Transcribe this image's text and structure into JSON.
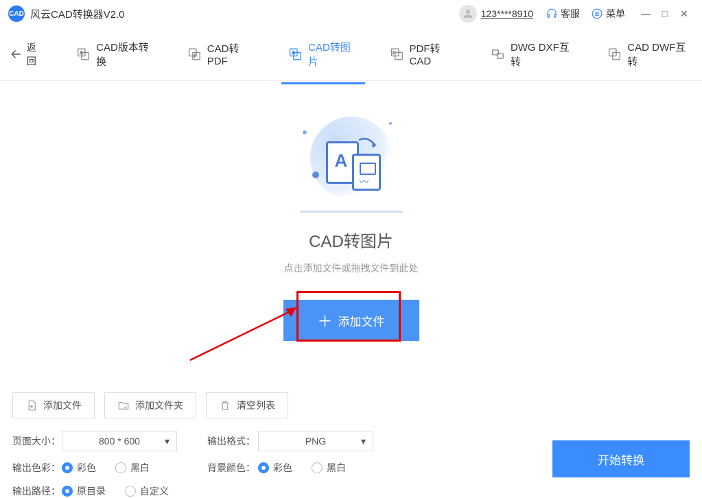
{
  "titlebar": {
    "app_title": "风云CAD转换器V2.0",
    "user_id": "123****8910",
    "support": "客服",
    "menu": "菜单"
  },
  "tabs": {
    "back": "返回",
    "items": [
      {
        "label": "CAD版本转换"
      },
      {
        "label": "CAD转PDF"
      },
      {
        "label": "CAD转图片"
      },
      {
        "label": "PDF转CAD"
      },
      {
        "label": "DWG DXF互转"
      },
      {
        "label": "CAD DWF互转"
      }
    ]
  },
  "main": {
    "title": "CAD转图片",
    "subtitle": "点击添加文件或拖拽文件到此处",
    "add_file": "添加文件"
  },
  "bottom": {
    "add_file": "添加文件",
    "add_folder": "添加文件夹",
    "clear_list": "清空列表",
    "page_size_label": "页面大小：",
    "page_size_value": "800 * 600",
    "output_format_label": "输出格式：",
    "output_format_value": "PNG",
    "output_color_label": "输出色彩：",
    "color_color": "彩色",
    "color_bw": "黑白",
    "bg_color_label": "背景颜色：",
    "output_path_label": "输出路径：",
    "path_original": "原目录",
    "path_custom": "自定义",
    "convert": "开始转换"
  }
}
